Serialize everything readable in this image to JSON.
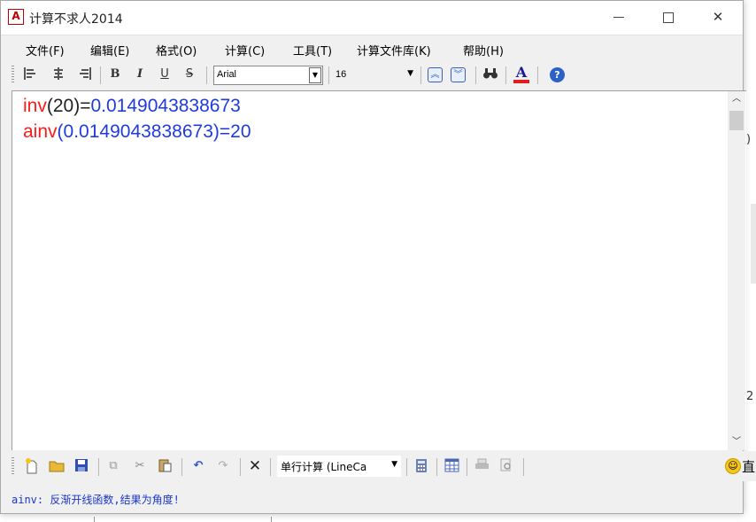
{
  "window": {
    "title": "计算不求人2014",
    "app_icon_label": "A"
  },
  "menu": {
    "items": [
      "文件(F)",
      "编辑(E)",
      "格式(O)",
      "计算(C)",
      "工具(T)",
      "计算文件库(K)",
      "帮助(H)"
    ]
  },
  "toolbar": {
    "font_name": "Arial",
    "font_size": "16",
    "icons": [
      "align-left-icon",
      "align-center-icon",
      "align-right-icon",
      "bold-icon",
      "italic-icon",
      "underline-icon",
      "strikethrough-icon",
      "scroll-up-icon",
      "scroll-down-icon",
      "find-icon",
      "font-color-icon",
      "help-icon"
    ]
  },
  "editor": {
    "lines": [
      {
        "func": "inv",
        "open": "(",
        "arg": "20",
        "close": ")",
        "eq": "=",
        "result": "0.0149043838673"
      },
      {
        "func": "ainv",
        "open": "(",
        "arg": "0.0149043838673",
        "close": ")",
        "eq": "=",
        "result": "20"
      }
    ]
  },
  "bottom_toolbar": {
    "mode_label": "单行计算 (LineCa",
    "edge_text": "直"
  },
  "status": {
    "message": "ainv: 反渐开线函数,结果为角度!"
  },
  "colors": {
    "function_name": "#ff1a1a",
    "result": "#1f3bdf",
    "status_text": "#1a36c8"
  }
}
